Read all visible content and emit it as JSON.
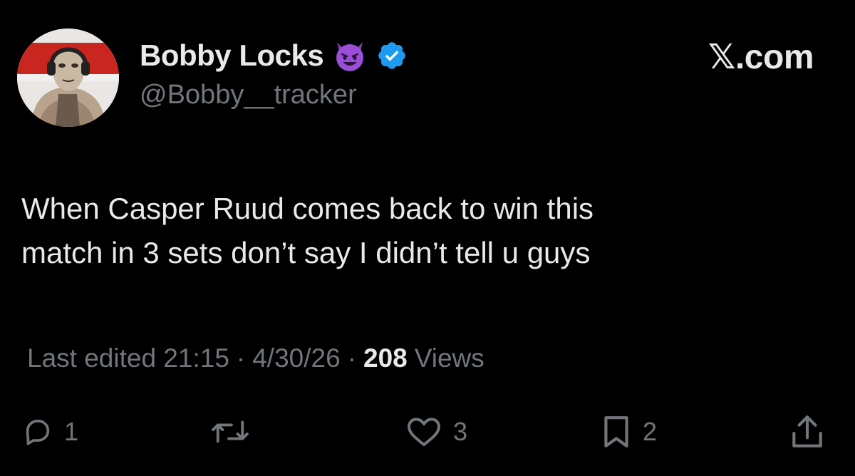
{
  "author": {
    "display_name": "Bobby Locks",
    "handle": "@Bobby__tracker",
    "avatar_icon": "avatar-masked-person",
    "badge_emoji_icon": "smiling-devil-emoji-icon",
    "verified_icon": "verified-badge-icon"
  },
  "site": {
    "label": "𝕏.com"
  },
  "tweet": {
    "lines": [
      "When Casper Ruud comes back to win this",
      "match in 3 sets don’t say I didn’t tell u guys"
    ]
  },
  "meta": {
    "edited_label": "Last edited 21:15",
    "separator": "·",
    "date": "4/30/26",
    "views_count": "208",
    "views_label": "Views"
  },
  "actions": {
    "reply_count": "1",
    "retweet_count": "",
    "like_count": "3",
    "bookmark_count": "2"
  },
  "colors": {
    "background": "#000000",
    "primary_text": "#e7e9ea",
    "secondary_text": "#71767b",
    "verified_blue": "#1d9bf0",
    "emoji_purple": "#9b4fd6"
  }
}
